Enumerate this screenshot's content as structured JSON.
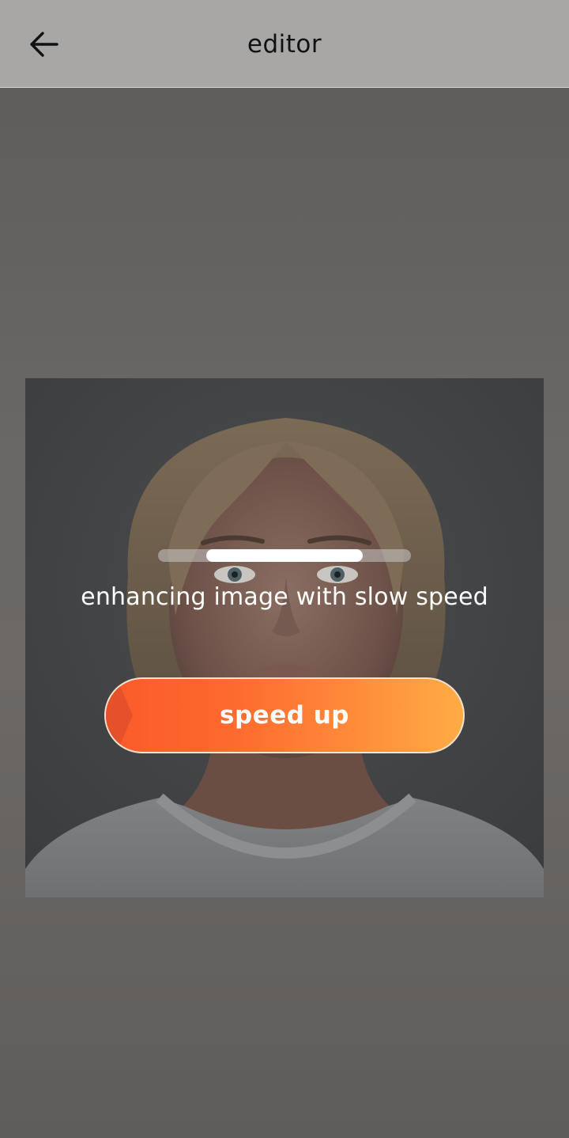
{
  "header": {
    "title": "editor",
    "back_icon": "arrow-left-icon"
  },
  "processing": {
    "status_text": "enhancing image with slow speed",
    "progress": 0.62
  },
  "actions": {
    "speed_up_label": "speed up"
  },
  "colors": {
    "accent_start": "#fb5a2a",
    "accent_end": "#ffac45",
    "topbar": "#a8a7a6"
  }
}
